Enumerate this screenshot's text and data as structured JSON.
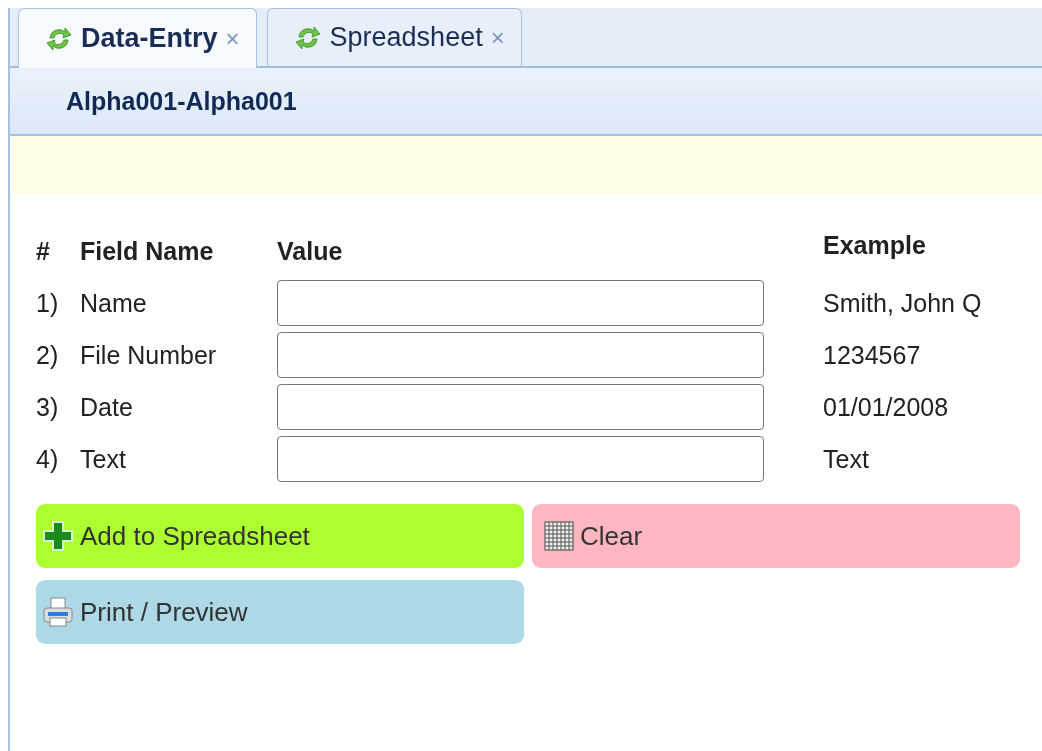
{
  "tabs": [
    {
      "label": "Data-Entry",
      "selected": true,
      "close": "×"
    },
    {
      "label": "Spreadsheet",
      "selected": false,
      "close": "×"
    }
  ],
  "header": {
    "title": "Alpha001-Alpha001"
  },
  "form": {
    "columns": {
      "number": "#",
      "field": "Field Name",
      "value": "Value",
      "example": "Example"
    },
    "rows": [
      {
        "number": "1)",
        "field": "Name",
        "example": "Smith, John Q"
      },
      {
        "number": "2)",
        "field": "File Number",
        "example": "1234567"
      },
      {
        "number": "3)",
        "field": "Date",
        "example": "01/01/2008"
      },
      {
        "number": "4)",
        "field": "Text",
        "example": "Text"
      }
    ]
  },
  "buttons": [
    {
      "label": "Add to Spreadsheet",
      "kind": "add"
    },
    {
      "label": "Clear",
      "kind": "clear"
    },
    {
      "label": "Print / Preview",
      "kind": "print"
    }
  ]
}
